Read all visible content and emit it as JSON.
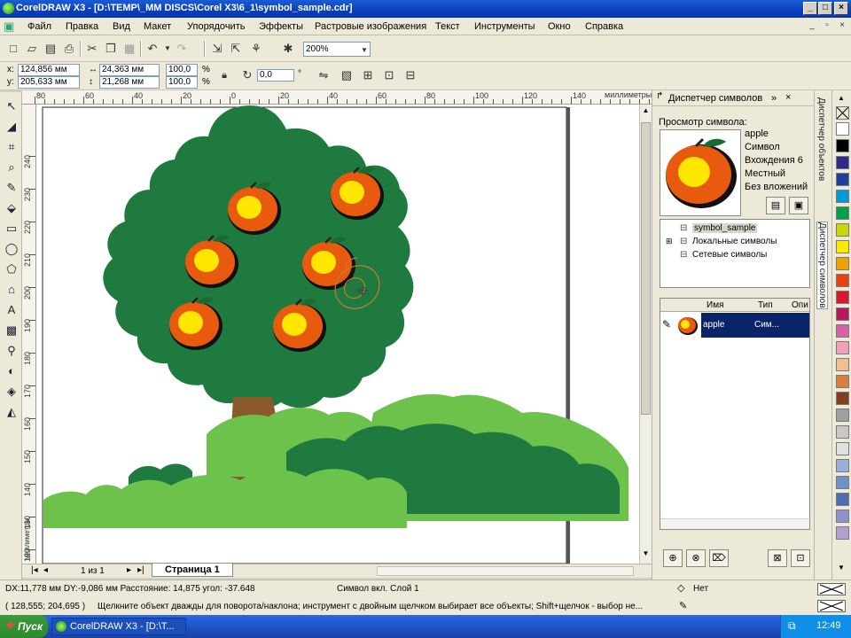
{
  "window": {
    "title": "CorelDRAW X3 - [D:\\TEMP\\_MM DISCS\\Corel X3\\6_1\\symbol_sample.cdr]"
  },
  "menu": [
    "Файл",
    "Правка",
    "Вид",
    "Макет",
    "Упорядочить",
    "Эффекты",
    "Растровые изображения",
    "Текст",
    "Инструменты",
    "Окно",
    "Справка"
  ],
  "standard_toolbar": {
    "zoom": "200%"
  },
  "property_bar": {
    "x_label": "x:",
    "x": "124,856 мм",
    "y_label": "y:",
    "y": "205,633 мм",
    "w": "24,363 мм",
    "h": "21,268 мм",
    "scale_w": "100,0",
    "scale_h": "100,0",
    "scale_unit": "%",
    "angle": "0,0",
    "angle_unit": "°"
  },
  "ruler": {
    "h_ticks": [
      "80",
      "60",
      "40",
      "20",
      "0",
      "20",
      "40",
      "60",
      "80",
      "100",
      "120",
      "140",
      "160",
      "180",
      "200",
      "220",
      "240"
    ],
    "unit": "миллиметры",
    "v_ticks": [
      "240",
      "230",
      "220",
      "210",
      "200",
      "190",
      "180",
      "170",
      "160",
      "150",
      "140",
      "130",
      "120"
    ],
    "v_unit": "миллиметры"
  },
  "page_nav": {
    "count": "1 из 1",
    "tab": "Страница 1"
  },
  "docker": {
    "title": "Диспетчер символов",
    "preview_label": "Просмотр символа:",
    "symbol_name": "apple",
    "symbol_kind": "Символ",
    "occurrences": "Вхождения 6",
    "scope": "Местный",
    "nesting": "Без вложений",
    "tree": [
      "symbol_sample",
      "Локальные символы",
      "Сетевые символы"
    ],
    "table_headers": [
      "Имя",
      "Тип",
      "Опи"
    ],
    "table_rows": [
      {
        "name": "apple",
        "type": "Сим..."
      }
    ]
  },
  "side_tabs": [
    "Диспетчер объектов",
    "Диспетчер символов"
  ],
  "palette": [
    "#ffffff",
    "#000000",
    "#2b2b8a",
    "#1e3f9a",
    "#0098d8",
    "#00a04a",
    "#c8d800",
    "#ffe800",
    "#f0a000",
    "#e84010",
    "#d81830",
    "#b8185a",
    "#d860a8",
    "#f0a0b8",
    "#f0c090",
    "#d88040",
    "#804020",
    "#a0a0a0",
    "#c8c8c8",
    "#e0e0e0",
    "#9ab0d8",
    "#7090c8",
    "#506cb0",
    "#9090c8",
    "#b0a0d0"
  ],
  "status": {
    "line1": "DX:11,778 мм DY:-9,086 мм Расстояние: 14,875 угол: -37.648",
    "object": "Символ вкл. Слой 1",
    "fill": "Нет",
    "line2": "( 128,555; 204,695 )",
    "hint": "Щелкните объект дважды для поворота/наклона; инструмент с двойным щелчком выбирает все объекты; Shift+щелчок - выбор не..."
  },
  "taskbar": {
    "start": "Пуск",
    "task": "CorelDRAW X3 - [D:\\T...",
    "clock": "12:49"
  }
}
